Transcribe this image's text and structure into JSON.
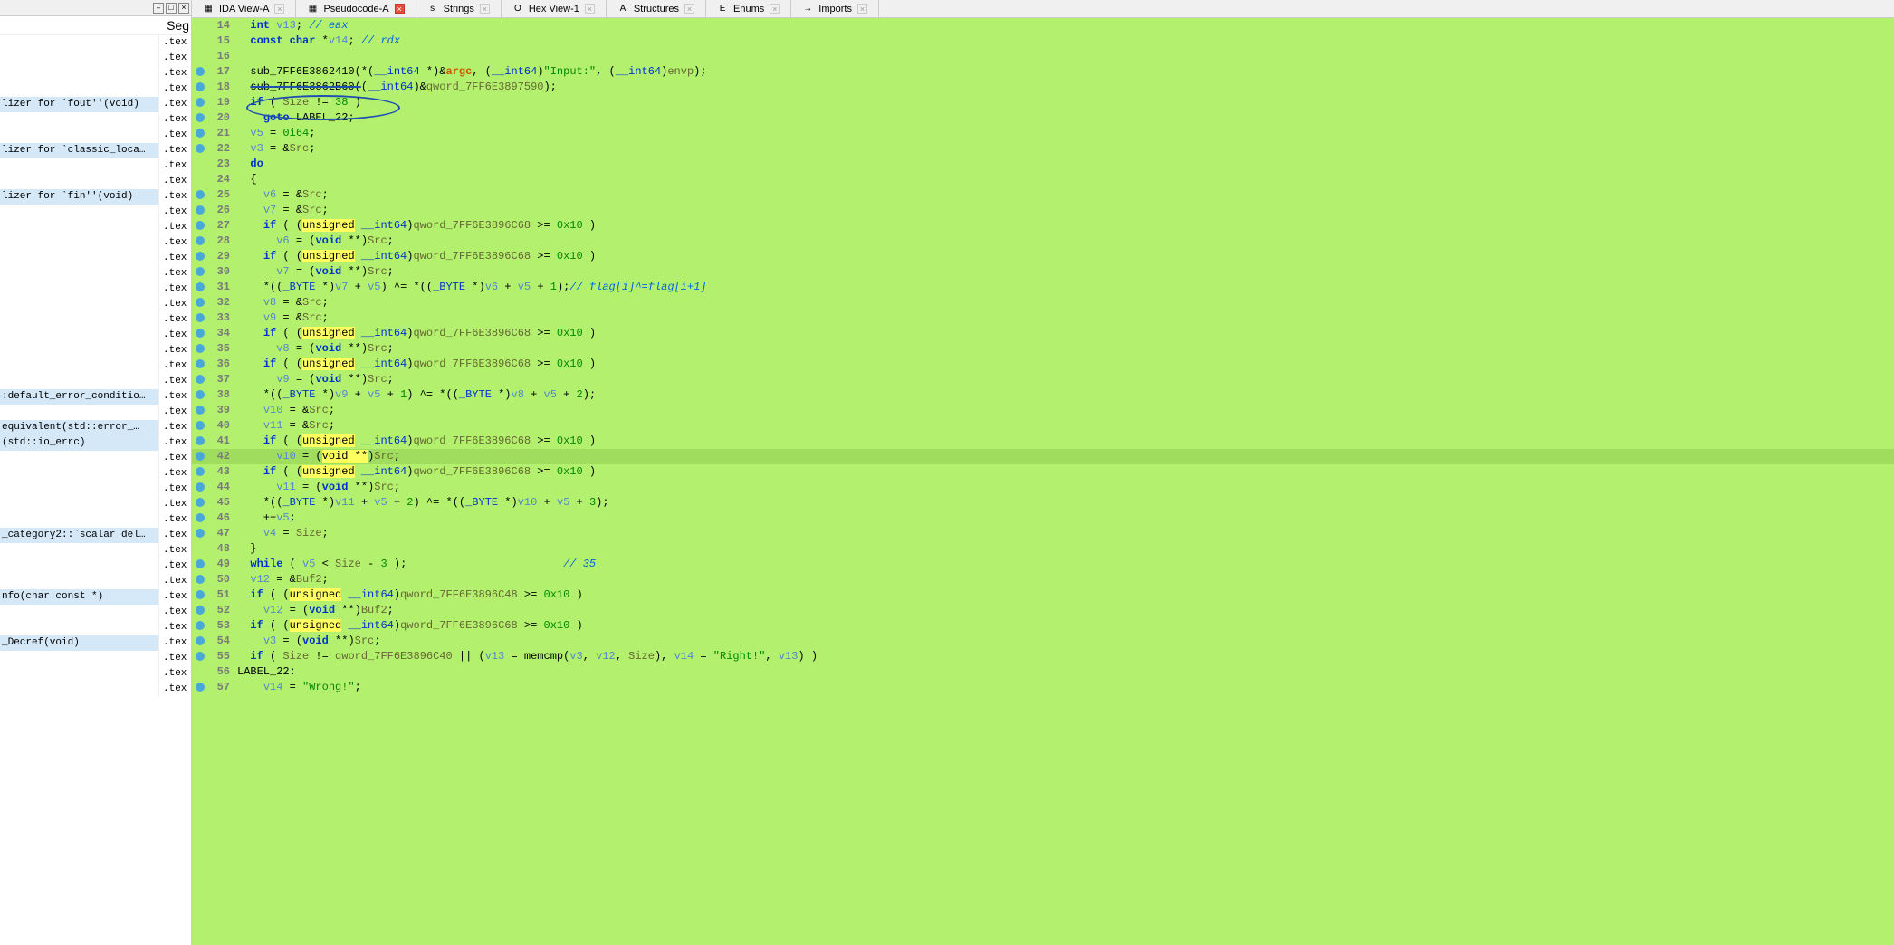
{
  "leftPanel": {
    "header": "Seg",
    "items": [
      {
        "name": "",
        "seg": ".tex",
        "hl": false
      },
      {
        "name": "",
        "seg": ".tex",
        "hl": false
      },
      {
        "name": "",
        "seg": ".tex",
        "hl": false
      },
      {
        "name": "",
        "seg": ".tex",
        "hl": false
      },
      {
        "name": "lizer for `fout''(void)",
        "seg": ".tex",
        "hl": true
      },
      {
        "name": "",
        "seg": ".tex",
        "hl": false
      },
      {
        "name": "",
        "seg": ".tex",
        "hl": false
      },
      {
        "name": "lizer for `classic_loca…",
        "seg": ".tex",
        "hl": true
      },
      {
        "name": "",
        "seg": ".tex",
        "hl": false
      },
      {
        "name": "",
        "seg": ".tex",
        "hl": false
      },
      {
        "name": "lizer for `fin''(void)",
        "seg": ".tex",
        "hl": true
      },
      {
        "name": "",
        "seg": ".tex",
        "hl": false
      },
      {
        "name": "",
        "seg": ".tex",
        "hl": false
      },
      {
        "name": "",
        "seg": ".tex",
        "hl": false
      },
      {
        "name": "",
        "seg": ".tex",
        "hl": false
      },
      {
        "name": "",
        "seg": ".tex",
        "hl": false
      },
      {
        "name": "",
        "seg": ".tex",
        "hl": false
      },
      {
        "name": "",
        "seg": ".tex",
        "hl": false
      },
      {
        "name": "",
        "seg": ".tex",
        "hl": false
      },
      {
        "name": "",
        "seg": ".tex",
        "hl": false
      },
      {
        "name": "",
        "seg": ".tex",
        "hl": false
      },
      {
        "name": "",
        "seg": ".tex",
        "hl": false
      },
      {
        "name": "",
        "seg": ".tex",
        "hl": false
      },
      {
        "name": ":default_error_conditio…",
        "seg": ".tex",
        "hl": true
      },
      {
        "name": "",
        "seg": ".tex",
        "hl": false
      },
      {
        "name": "equivalent(std::error_…",
        "seg": ".tex",
        "hl": true
      },
      {
        "name": "(std::io_errc)",
        "seg": ".tex",
        "hl": true
      },
      {
        "name": "",
        "seg": ".tex",
        "hl": false
      },
      {
        "name": "",
        "seg": ".tex",
        "hl": false
      },
      {
        "name": "",
        "seg": ".tex",
        "hl": false
      },
      {
        "name": "",
        "seg": ".tex",
        "hl": false
      },
      {
        "name": "",
        "seg": ".tex",
        "hl": false
      },
      {
        "name": "_category2::`scalar del…",
        "seg": ".tex",
        "hl": true
      },
      {
        "name": "",
        "seg": ".tex",
        "hl": false
      },
      {
        "name": "",
        "seg": ".tex",
        "hl": false
      },
      {
        "name": "",
        "seg": ".tex",
        "hl": false
      },
      {
        "name": "nfo(char const *)",
        "seg": ".tex",
        "hl": true
      },
      {
        "name": "",
        "seg": ".tex",
        "hl": false
      },
      {
        "name": "",
        "seg": ".tex",
        "hl": false
      },
      {
        "name": "_Decref(void)",
        "seg": ".tex",
        "hl": true
      },
      {
        "name": "",
        "seg": ".tex",
        "hl": false
      },
      {
        "name": "",
        "seg": ".tex",
        "hl": false
      },
      {
        "name": "",
        "seg": ".tex",
        "hl": false
      }
    ]
  },
  "tabs": [
    {
      "label": "IDA View-A",
      "icon": "▦",
      "active": false
    },
    {
      "label": "Pseudocode-A",
      "icon": "▦",
      "active": true
    },
    {
      "label": "Strings",
      "icon": "s",
      "active": false
    },
    {
      "label": "Hex View-1",
      "icon": "O",
      "active": false
    },
    {
      "label": "Structures",
      "icon": "A",
      "active": false
    },
    {
      "label": "Enums",
      "icon": "E",
      "active": false
    },
    {
      "label": "Imports",
      "icon": "→",
      "active": false
    }
  ],
  "code": {
    "startLine": 14,
    "currentLine": 42,
    "lines": [
      {
        "n": 14,
        "bp": false,
        "html": "  <span class='kw'>int</span> <span class='var'>v13</span>; <span class='comment'>// eax</span>"
      },
      {
        "n": 15,
        "bp": false,
        "html": "  <span class='kw'>const char</span> *<span class='var'>v14</span>; <span class='comment'>// rdx</span>"
      },
      {
        "n": 16,
        "bp": false,
        "html": ""
      },
      {
        "n": 17,
        "bp": true,
        "html": "  <span class='func'>sub_7FF6E3862410</span>(*(<span class='type'>__int64</span> *)&amp;<span class='param'>argc</span>, (<span class='type'>__int64</span>)<span class='str'>\"Input:\"</span>, (<span class='type'>__int64</span>)<span class='global'>envp</span>);"
      },
      {
        "n": 18,
        "bp": true,
        "html": "  <span class='func strike'>sub_7FF6E3862B60(</span>(<span class='type'>__int64</span>)&amp;<span class='global'>qword_7FF6E3897590</span>);"
      },
      {
        "n": 19,
        "bp": true,
        "html": "  <span class='kw'>if</span> ( <span class='global'>Size</span> != <span class='num'>38</span> )"
      },
      {
        "n": 20,
        "bp": true,
        "html": "    <span class='kw'>goto</span> <span class='func'>LABEL_22</span>;"
      },
      {
        "n": 21,
        "bp": true,
        "html": "  <span class='var'>v5</span> = <span class='num'>0i64</span>;"
      },
      {
        "n": 22,
        "bp": true,
        "html": "  <span class='var'>v3</span> = &amp;<span class='global'>Src</span>;"
      },
      {
        "n": 23,
        "bp": false,
        "html": "  <span class='kw'>do</span>"
      },
      {
        "n": 24,
        "bp": false,
        "html": "  {"
      },
      {
        "n": 25,
        "bp": true,
        "html": "    <span class='var'>v6</span> = &amp;<span class='global'>Src</span>;"
      },
      {
        "n": 26,
        "bp": true,
        "html": "    <span class='var'>v7</span> = &amp;<span class='global'>Src</span>;"
      },
      {
        "n": 27,
        "bp": true,
        "html": "    <span class='kw'>if</span> ( (<span class='hl'>unsigned</span> <span class='type'>__int64</span>)<span class='global'>qword_7FF6E3896C68</span> &gt;= <span class='num'>0x10</span> )"
      },
      {
        "n": 28,
        "bp": true,
        "html": "      <span class='var'>v6</span> = (<span class='kw'>void</span> **)<span class='global'>Src</span>;"
      },
      {
        "n": 29,
        "bp": true,
        "html": "    <span class='kw'>if</span> ( (<span class='hl'>unsigned</span> <span class='type'>__int64</span>)<span class='global'>qword_7FF6E3896C68</span> &gt;= <span class='num'>0x10</span> )"
      },
      {
        "n": 30,
        "bp": true,
        "html": "      <span class='var'>v7</span> = (<span class='kw'>void</span> **)<span class='global'>Src</span>;"
      },
      {
        "n": 31,
        "bp": true,
        "html": "    *((<span class='type'>_BYTE</span> *)<span class='var'>v7</span> + <span class='var'>v5</span>) ^= *((<span class='type'>_BYTE</span> *)<span class='var'>v6</span> + <span class='var'>v5</span> + <span class='num'>1</span>);<span class='comment'>// flag[i]^=flag[i+1]</span>"
      },
      {
        "n": 32,
        "bp": true,
        "html": "    <span class='var'>v8</span> = &amp;<span class='global'>Src</span>;"
      },
      {
        "n": 33,
        "bp": true,
        "html": "    <span class='var'>v9</span> = &amp;<span class='global'>Src</span>;"
      },
      {
        "n": 34,
        "bp": true,
        "html": "    <span class='kw'>if</span> ( (<span class='hl'>unsigned</span> <span class='type'>__int64</span>)<span class='global'>qword_7FF6E3896C68</span> &gt;= <span class='num'>0x10</span> )"
      },
      {
        "n": 35,
        "bp": true,
        "html": "      <span class='var'>v8</span> = (<span class='kw'>void</span> **)<span class='global'>Src</span>;"
      },
      {
        "n": 36,
        "bp": true,
        "html": "    <span class='kw'>if</span> ( (<span class='hl'>unsigned</span> <span class='type'>__int64</span>)<span class='global'>qword_7FF6E3896C68</span> &gt;= <span class='num'>0x10</span> )"
      },
      {
        "n": 37,
        "bp": true,
        "html": "      <span class='var'>v9</span> = (<span class='kw'>void</span> **)<span class='global'>Src</span>;"
      },
      {
        "n": 38,
        "bp": true,
        "html": "    *((<span class='type'>_BYTE</span> *)<span class='var'>v9</span> + <span class='var'>v5</span> + <span class='num'>1</span>) ^= *((<span class='type'>_BYTE</span> *)<span class='var'>v8</span> + <span class='var'>v5</span> + <span class='num'>2</span>);"
      },
      {
        "n": 39,
        "bp": true,
        "html": "    <span class='var'>v10</span> = &amp;<span class='global'>Src</span>;"
      },
      {
        "n": 40,
        "bp": true,
        "html": "    <span class='var'>v11</span> = &amp;<span class='global'>Src</span>;"
      },
      {
        "n": 41,
        "bp": true,
        "html": "    <span class='kw'>if</span> ( (<span class='hl'>unsigned</span> <span class='type'>__int64</span>)<span class='global'>qword_7FF6E3896C68</span> &gt;= <span class='num'>0x10</span> )"
      },
      {
        "n": 42,
        "bp": true,
        "html": "      <span class='var'>v10</span> = (<span class='hl'>void **</span>)<span class='global'>Src</span>;"
      },
      {
        "n": 43,
        "bp": true,
        "html": "    <span class='kw'>if</span> ( (<span class='hl'>unsigned</span> <span class='type'>__int64</span>)<span class='global'>qword_7FF6E3896C68</span> &gt;= <span class='num'>0x10</span> )"
      },
      {
        "n": 44,
        "bp": true,
        "html": "      <span class='var'>v11</span> = (<span class='kw'>void</span> **)<span class='global'>Src</span>;"
      },
      {
        "n": 45,
        "bp": true,
        "html": "    *((<span class='type'>_BYTE</span> *)<span class='var'>v11</span> + <span class='var'>v5</span> + <span class='num'>2</span>) ^= *((<span class='type'>_BYTE</span> *)<span class='var'>v10</span> + <span class='var'>v5</span> + <span class='num'>3</span>);"
      },
      {
        "n": 46,
        "bp": true,
        "html": "    ++<span class='var'>v5</span>;"
      },
      {
        "n": 47,
        "bp": true,
        "html": "    <span class='var'>v4</span> = <span class='global'>Size</span>;"
      },
      {
        "n": 48,
        "bp": false,
        "html": "  }"
      },
      {
        "n": 49,
        "bp": true,
        "html": "  <span class='kw'>while</span> ( <span class='var'>v5</span> &lt; <span class='global'>Size</span> - <span class='num'>3</span> );                        <span class='comment'>// 35</span>"
      },
      {
        "n": 50,
        "bp": true,
        "html": "  <span class='var'>v12</span> = &amp;<span class='global'>Buf2</span>;"
      },
      {
        "n": 51,
        "bp": true,
        "html": "  <span class='kw'>if</span> ( (<span class='hl'>unsigned</span> <span class='type'>__int64</span>)<span class='global'>qword_7FF6E3896C48</span> &gt;= <span class='num'>0x10</span> )"
      },
      {
        "n": 52,
        "bp": true,
        "html": "    <span class='var'>v12</span> = (<span class='kw'>void</span> **)<span class='global'>Buf2</span>;"
      },
      {
        "n": 53,
        "bp": true,
        "html": "  <span class='kw'>if</span> ( (<span class='hl'>unsigned</span> <span class='type'>__int64</span>)<span class='global'>qword_7FF6E3896C68</span> &gt;= <span class='num'>0x10</span> )"
      },
      {
        "n": 54,
        "bp": true,
        "html": "    <span class='var'>v3</span> = (<span class='kw'>void</span> **)<span class='global'>Src</span>;"
      },
      {
        "n": 55,
        "bp": true,
        "html": "  <span class='kw'>if</span> ( <span class='global'>Size</span> != <span class='global'>qword_7FF6E3896C40</span> || (<span class='var'>v13</span> = <span class='func'>memcmp</span>(<span class='var'>v3</span>, <span class='var'>v12</span>, <span class='global'>Size</span>), <span class='var'>v14</span> = <span class='str'>\"Right!\"</span>, <span class='var'>v13</span>) )"
      },
      {
        "n": 56,
        "bp": false,
        "html": "<span class='func'>LABEL_22</span>:"
      },
      {
        "n": 57,
        "bp": true,
        "html": "    <span class='var'>v14</span> = <span class='str'>\"Wrong!\"</span>;"
      }
    ]
  }
}
